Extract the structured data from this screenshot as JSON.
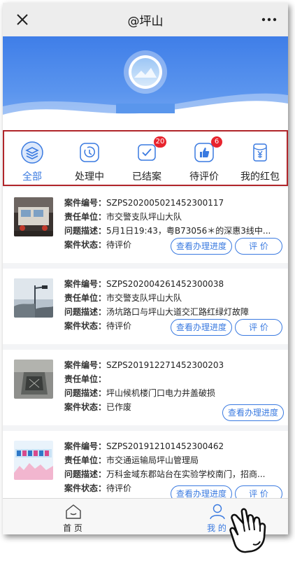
{
  "header": {
    "title": "@坪山"
  },
  "nav": {
    "items": [
      {
        "label": "全部",
        "icon": "layers-icon"
      },
      {
        "label": "处理中",
        "icon": "clock-icon"
      },
      {
        "label": "已结案",
        "icon": "checkbox-icon",
        "badge": "20"
      },
      {
        "label": "待评价",
        "icon": "thumbs-up-icon",
        "badge": "6"
      },
      {
        "label": "我的红包",
        "icon": "red-packet-icon"
      }
    ],
    "active_index": 0
  },
  "labels": {
    "case_no": "案件编号：",
    "unit": "责任单位：",
    "desc": "问题描述：",
    "status": "案件状态："
  },
  "cases": [
    {
      "case_no": "SZPS202005021452300117",
      "unit": "市交警支队坪山大队",
      "desc": "5月1日19:43，粤B73056＊的深惠3线中...",
      "status": "待评价",
      "progress_label": "查看办理进度",
      "rate_label": "评 价"
    },
    {
      "case_no": "SZPS202004261452300038",
      "unit": "市交警支队坪山大队",
      "desc": "汤坑路口与坪山大道交汇路红绿灯故障",
      "status": "待评价",
      "progress_label": "查看办理进度",
      "rate_label": "评 价"
    },
    {
      "case_no": "SZPS201912271452300203",
      "unit": "",
      "desc": "坪山候机楼门口电力井盖破损",
      "status": "已作废",
      "progress_label": "查看办理进度"
    },
    {
      "case_no": "SZPS201912101452300462",
      "unit": "市交通运输局坪山管理局",
      "desc": "万科金域东郡站台在实验学校南门，招商...",
      "status": "待评价",
      "progress_label": "查看办理进度",
      "rate_label": "评 价"
    }
  ],
  "tabbar": {
    "home": "首 页",
    "mine": "我 的"
  },
  "colors": {
    "accent": "#3a7ae0",
    "badge": "#e8242e",
    "highlight_border": "#b0252a"
  }
}
